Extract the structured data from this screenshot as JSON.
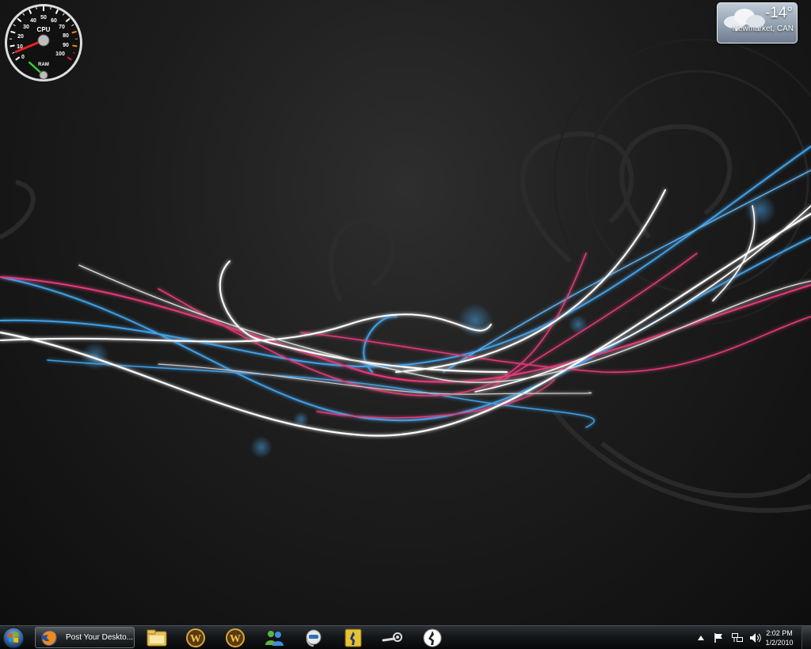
{
  "meter": {
    "cpu_label": "CPU",
    "ram_label": "RAM",
    "scale_labels": [
      "0",
      "10",
      "20",
      "30",
      "40",
      "50",
      "60",
      "70",
      "80",
      "90",
      "100"
    ],
    "cpu_percent": 5,
    "ram_percent": 20
  },
  "weather": {
    "temperature": "-14°",
    "location": "Newmarket, CAN"
  },
  "taskbar": {
    "active_window_label": "Post Your Deskto...",
    "pinned": [
      {
        "name": "windows-explorer-icon"
      },
      {
        "name": "world-of-warcraft-icon"
      },
      {
        "name": "world-of-warcraft-icon-2"
      },
      {
        "name": "windows-live-messenger-icon"
      },
      {
        "name": "ventrilo-icon"
      },
      {
        "name": "counter-strike-icon"
      },
      {
        "name": "steam-icon"
      },
      {
        "name": "counter-strike-source-icon"
      }
    ]
  },
  "tray": {
    "time": "2:02 PM",
    "date": "1/2/2010"
  },
  "colors": {
    "wave_blue": "#3fa0e6",
    "wave_pink": "#e23a7a",
    "wave_white": "#ffffff"
  }
}
